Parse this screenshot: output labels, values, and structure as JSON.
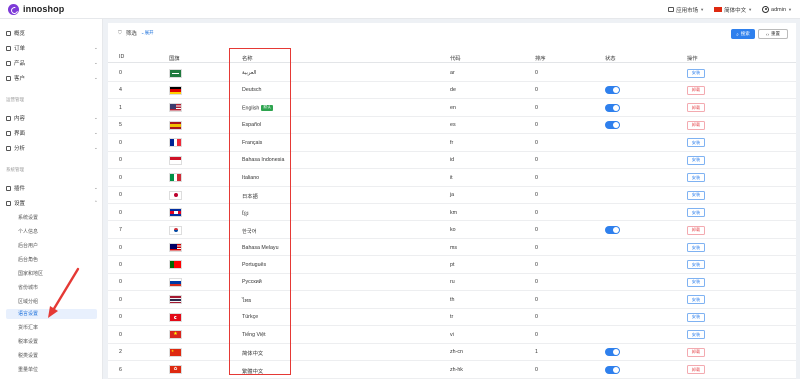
{
  "app": {
    "brand": "innoshop"
  },
  "topbar": {
    "store_label": "应用市场",
    "language_label": "简体中文",
    "user_label": "admin"
  },
  "sidebar": {
    "items": [
      {
        "label": "概览",
        "icon": "home-icon"
      },
      {
        "label": "订单",
        "icon": "order-icon"
      },
      {
        "label": "产品",
        "icon": "product-icon"
      },
      {
        "label": "客户",
        "icon": "customer-icon"
      }
    ],
    "group_content": "运营管理",
    "content_items": [
      {
        "label": "内容",
        "icon": "content-icon"
      },
      {
        "label": "界面",
        "icon": "design-icon"
      },
      {
        "label": "分析",
        "icon": "analytics-icon"
      }
    ],
    "group_system": "系统管理",
    "system_items": [
      {
        "label": "插件",
        "icon": "plugin-icon"
      },
      {
        "label": "设置",
        "icon": "settings-icon"
      }
    ],
    "settings_sub": [
      "系统设置",
      "个人信息",
      "后台用户",
      "后台角色",
      "国家和地区",
      "省份城市",
      "区域分组",
      "语言设置",
      "货币汇率",
      "税率设置",
      "税类设置",
      "重量单位"
    ],
    "active_sub": "语言设置"
  },
  "filter": {
    "label": "筛选",
    "expand": "展开",
    "search_btn": "搜索",
    "reset_btn": "重置"
  },
  "table": {
    "headers": {
      "id": "ID",
      "flag": "国旗",
      "name": "名称",
      "code": "代码",
      "sort": "排序",
      "status": "状态",
      "action": "操作"
    },
    "default_badge": "默认",
    "install_label": "安装",
    "uninstall_label": "卸载",
    "rows": [
      {
        "id": "0",
        "flag": "ar",
        "name": "العربية",
        "code": "ar",
        "sort": "0",
        "enabled": false,
        "installed": false
      },
      {
        "id": "4",
        "flag": "de",
        "name": "Deutsch",
        "code": "de",
        "sort": "0",
        "enabled": true,
        "installed": true
      },
      {
        "id": "1",
        "flag": "en",
        "name": "English",
        "code": "en",
        "sort": "0",
        "enabled": true,
        "installed": true,
        "default": true
      },
      {
        "id": "5",
        "flag": "es",
        "name": "Español",
        "code": "es",
        "sort": "0",
        "enabled": true,
        "installed": true
      },
      {
        "id": "0",
        "flag": "fr",
        "name": "Français",
        "code": "fr",
        "sort": "0",
        "enabled": false,
        "installed": false
      },
      {
        "id": "0",
        "flag": "id",
        "name": "Bahasa Indonesia",
        "code": "id",
        "sort": "0",
        "enabled": false,
        "installed": false
      },
      {
        "id": "0",
        "flag": "it",
        "name": "Italiano",
        "code": "it",
        "sort": "0",
        "enabled": false,
        "installed": false
      },
      {
        "id": "0",
        "flag": "ja",
        "name": "日本語",
        "code": "ja",
        "sort": "0",
        "enabled": false,
        "installed": false
      },
      {
        "id": "0",
        "flag": "km",
        "name": "ខ្មែរ",
        "code": "km",
        "sort": "0",
        "enabled": false,
        "installed": false
      },
      {
        "id": "7",
        "flag": "ko",
        "name": "한국어",
        "code": "ko",
        "sort": "0",
        "enabled": true,
        "installed": true
      },
      {
        "id": "0",
        "flag": "ms",
        "name": "Bahasa Melayu",
        "code": "ms",
        "sort": "0",
        "enabled": false,
        "installed": false
      },
      {
        "id": "0",
        "flag": "pt",
        "name": "Português",
        "code": "pt",
        "sort": "0",
        "enabled": false,
        "installed": false
      },
      {
        "id": "0",
        "flag": "ru",
        "name": "Русский",
        "code": "ru",
        "sort": "0",
        "enabled": false,
        "installed": false
      },
      {
        "id": "0",
        "flag": "th",
        "name": "ไทย",
        "code": "th",
        "sort": "0",
        "enabled": false,
        "installed": false
      },
      {
        "id": "0",
        "flag": "tr",
        "name": "Türkçe",
        "code": "tr",
        "sort": "0",
        "enabled": false,
        "installed": false
      },
      {
        "id": "0",
        "flag": "vi",
        "name": "Tiếng Việt",
        "code": "vi",
        "sort": "0",
        "enabled": false,
        "installed": false
      },
      {
        "id": "2",
        "flag": "zh-cn",
        "name": "简体中文",
        "code": "zh-cn",
        "sort": "1",
        "enabled": true,
        "installed": true
      },
      {
        "id": "6",
        "flag": "zh-hk",
        "name": "繁體中文",
        "code": "zh-hk",
        "sort": "0",
        "enabled": true,
        "installed": true
      }
    ]
  },
  "colors": {
    "accent": "#2f80ed",
    "danger": "#e5484d",
    "brand": "#7d3ad8",
    "highlight": "#e53935"
  }
}
